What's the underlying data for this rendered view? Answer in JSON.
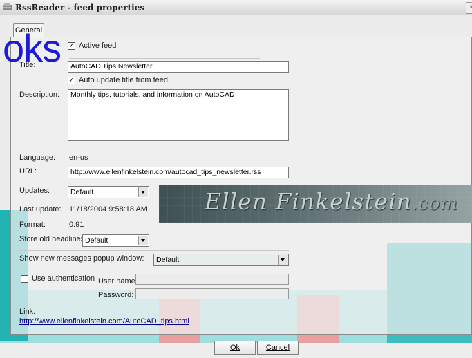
{
  "window": {
    "title": "RssReader - feed properties",
    "close_glyph": "×"
  },
  "tabs": [
    {
      "label": "General"
    }
  ],
  "watermark": "oks",
  "active_feed": {
    "label": "Active feed",
    "checked": true
  },
  "title_field": {
    "label": "Title:",
    "value": "AutoCAD Tips Newsletter"
  },
  "auto_update": {
    "label": "Auto update title from feed",
    "checked": true
  },
  "description": {
    "label": "Description:",
    "value": "Monthly tips, tutorials, and information on AutoCAD"
  },
  "language": {
    "label": "Language:",
    "value": "en-us"
  },
  "url": {
    "label": "URL:",
    "value": "http://www.ellenfinkelstein.com/autocad_tips_newsletter.rss"
  },
  "updates": {
    "label": "Updates:",
    "value": "Default"
  },
  "last_update": {
    "label": "Last update:",
    "value": "11/18/2004 9:58:18 AM"
  },
  "format": {
    "label": "Format:",
    "value": "0.91"
  },
  "store_old": {
    "label": "Store old headlines:",
    "value": "Default"
  },
  "popup": {
    "label": "Show new messages popup window:",
    "value": "Default"
  },
  "auth": {
    "label": "Use authentication",
    "checked": false,
    "username_label": "User name:",
    "password_label": "Password:",
    "username": "",
    "password": ""
  },
  "link": {
    "label": "Link:",
    "value": "http://www.ellenfinkelstein.com/AutoCAD_tips.html"
  },
  "banner": {
    "text": "Ellen Finkelstein",
    "suffix": ".com"
  },
  "buttons": {
    "ok": "Ok",
    "cancel": "Cancel"
  },
  "colors": {
    "accent_teal": "#1fb4b4",
    "accent_red": "#d86a6a",
    "banner_bg": "#4d5e60",
    "link": "#00008b"
  }
}
